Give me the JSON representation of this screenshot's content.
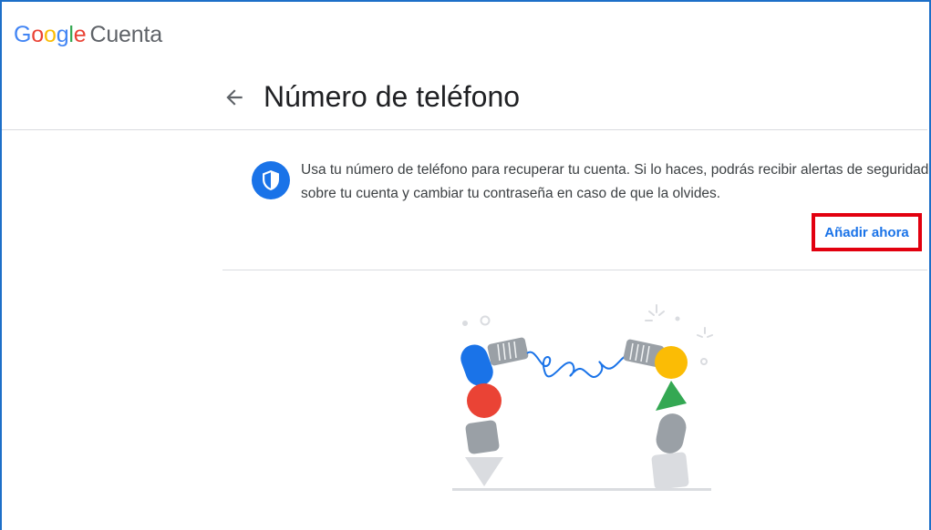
{
  "header": {
    "logo_letters": [
      {
        "char": "G",
        "color": "#4285f4"
      },
      {
        "char": "o",
        "color": "#ea4335"
      },
      {
        "char": "o",
        "color": "#fbbc05"
      },
      {
        "char": "g",
        "color": "#4285f4"
      },
      {
        "char": "l",
        "color": "#34a853"
      },
      {
        "char": "e",
        "color": "#ea4335"
      }
    ],
    "product_name": "Cuenta"
  },
  "page": {
    "title": "Número de teléfono",
    "back_icon": "arrow-left-icon"
  },
  "info": {
    "icon": "shield-icon",
    "text": "Usa tu número de teléfono para recuperar tu cuenta. Si lo haces, podrás recibir alertas de seguridad sobre tu cuenta y cambiar tu contraseña en caso de que la olvides.",
    "action_label": "Añadir ahora",
    "highlight_color": "#e2000f",
    "accent_color": "#1a73e8"
  },
  "illustration": {
    "icon": "phone-cord-illustration"
  }
}
